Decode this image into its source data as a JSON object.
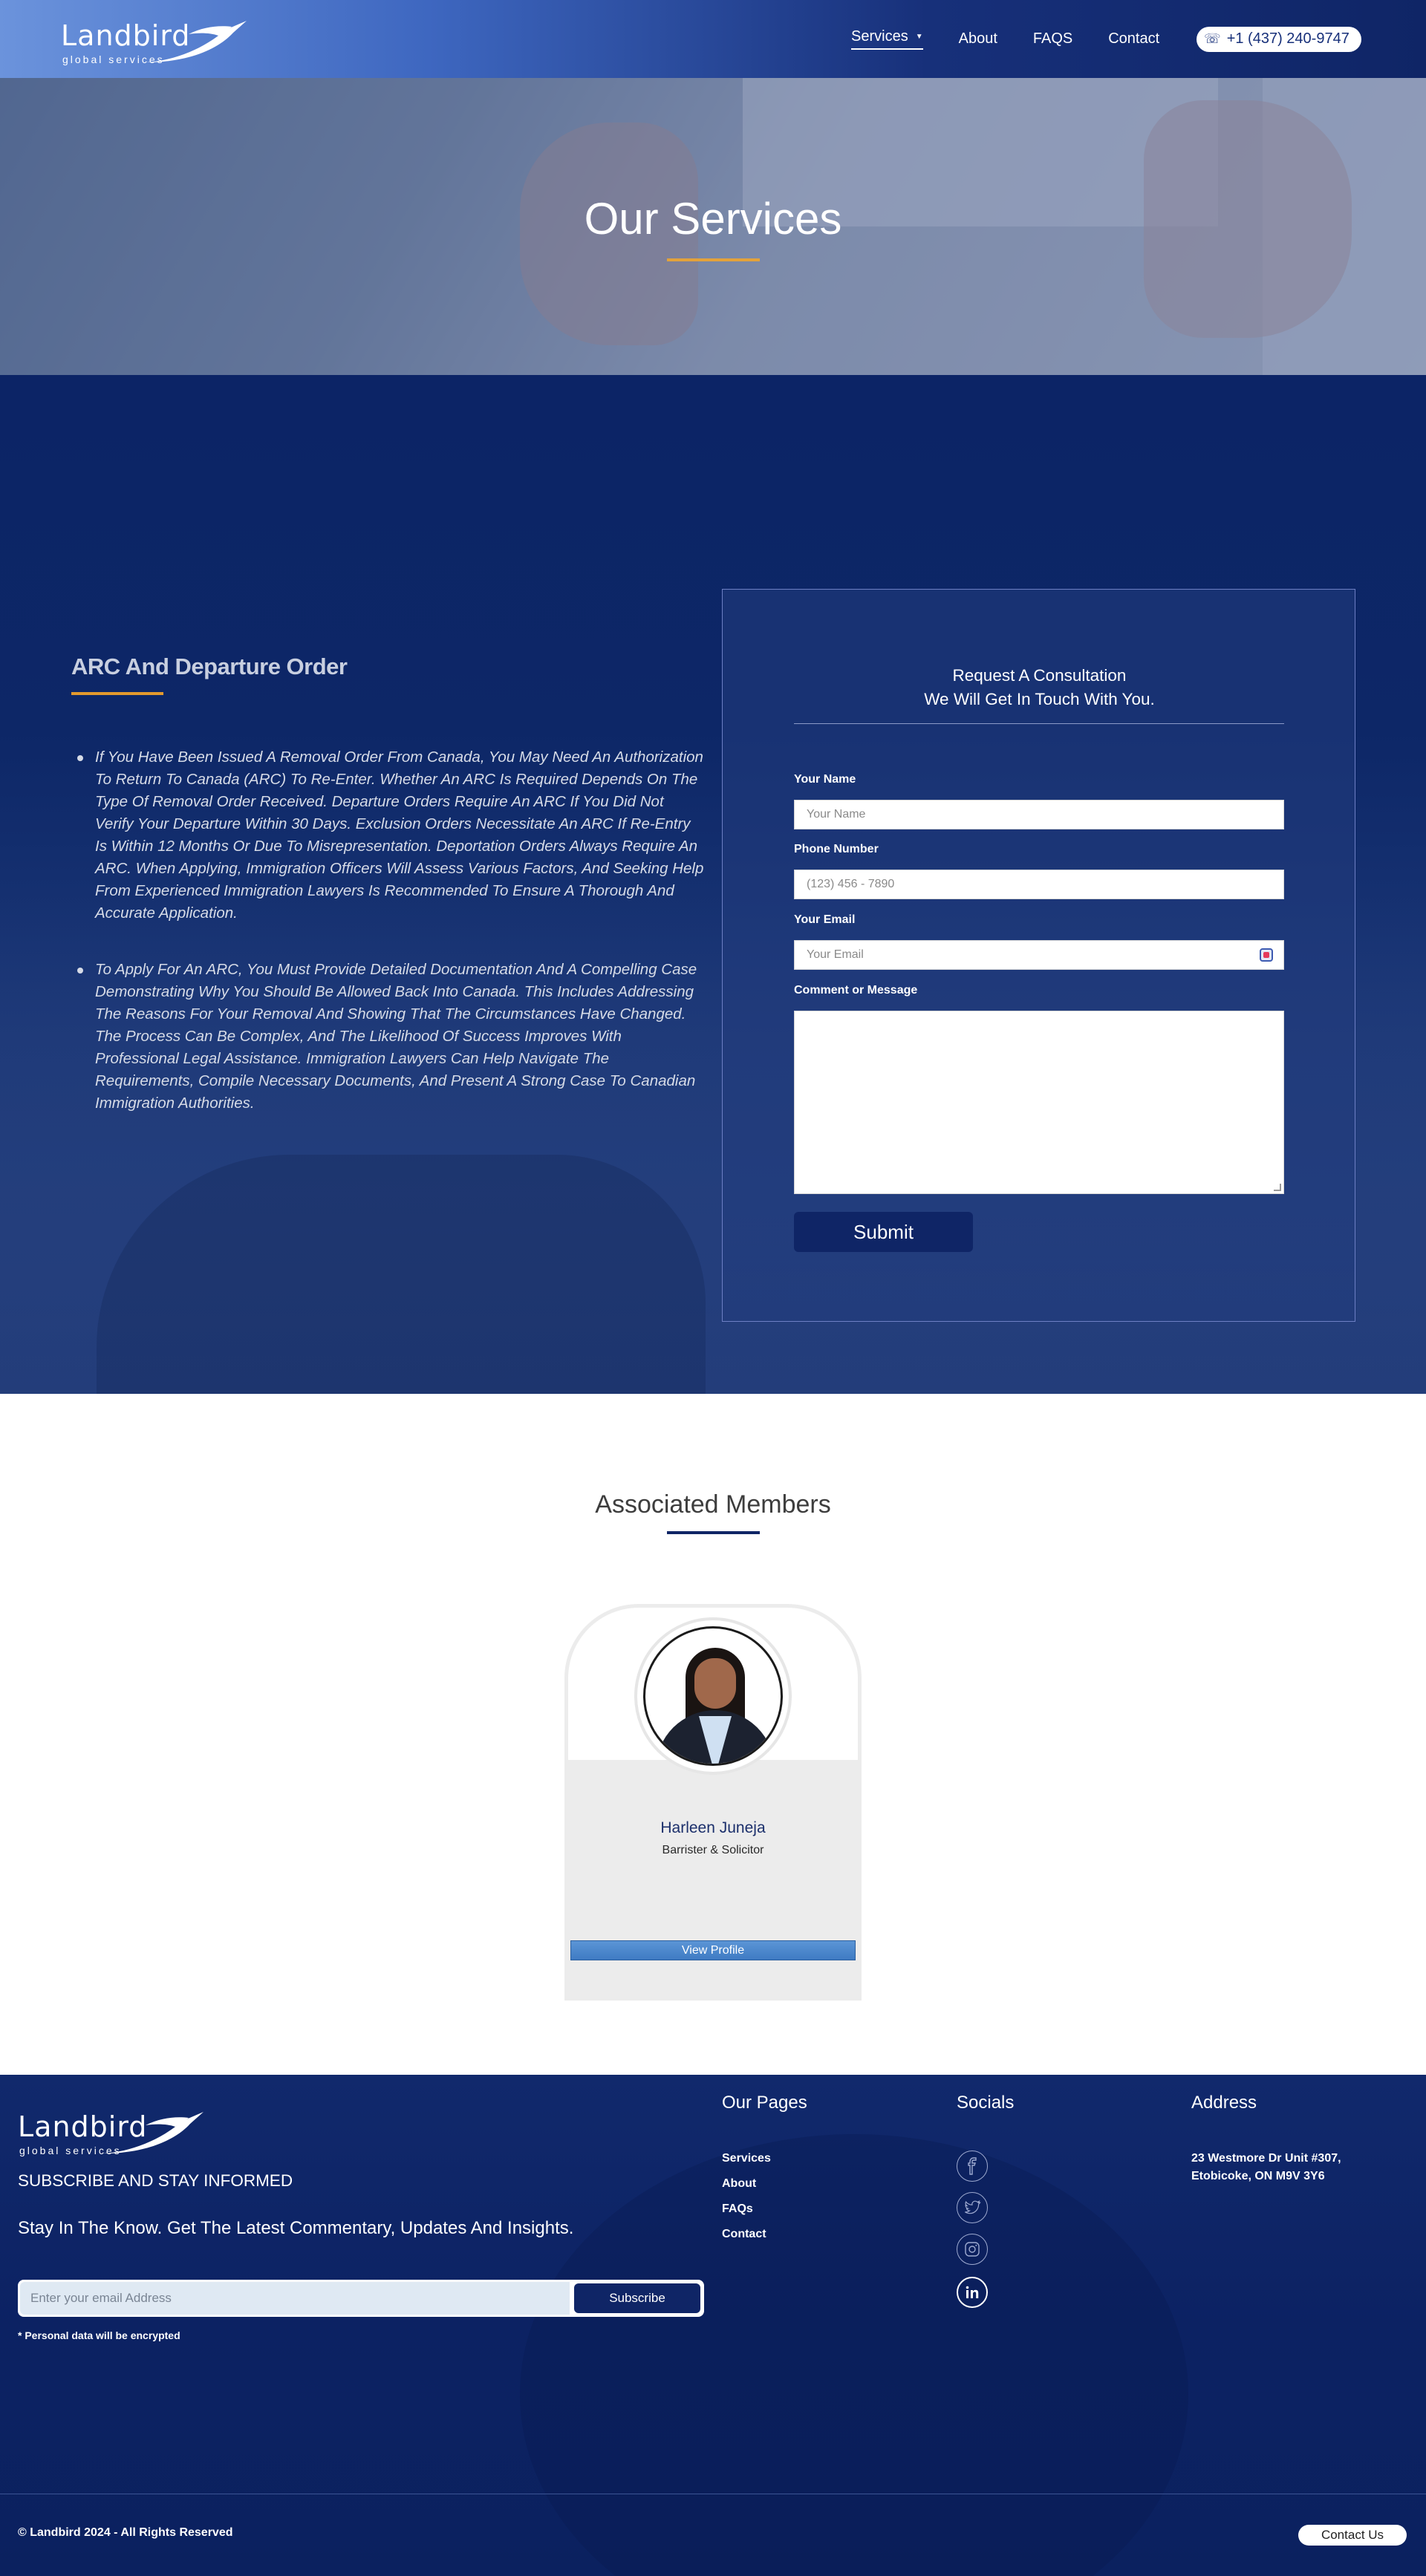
{
  "header": {
    "logo": {
      "wordmark": "Landbird",
      "tagline": "global services"
    },
    "nav": [
      {
        "label": "Services"
      },
      {
        "label": "About"
      },
      {
        "label": "FAQS"
      },
      {
        "label": "Contact"
      }
    ],
    "phone": "+1 (437) 240-9747"
  },
  "hero": {
    "title": "Our Services"
  },
  "service": {
    "heading": "ARC And Departure Order",
    "paragraphs": [
      "If You Have Been Issued A Removal Order From Canada, You May Need An Authorization To Return To Canada (ARC) To Re-Enter. Whether An ARC Is Required Depends On The Type Of Removal Order Received. Departure Orders Require An ARC If You Did Not Verify Your Departure Within 30 Days. Exclusion Orders Necessitate An ARC If Re-Entry Is Within 12 Months Or Due To Misrepresentation. Deportation Orders Always Require An ARC. When Applying, Immigration Officers Will Assess Various Factors, And Seeking Help From Experienced Immigration Lawyers Is Recommended To Ensure A Thorough And Accurate Application.",
      "To Apply For An ARC, You Must Provide Detailed Documentation And A Compelling Case Demonstrating Why You Should Be Allowed Back Into Canada. This Includes Addressing The Reasons For Your Removal And Showing That The Circumstances Have Changed. The Process Can Be Complex, And The Likelihood Of Success Improves With Professional Legal Assistance. Immigration Lawyers Can Help Navigate The Requirements, Compile Necessary Documents, And Present A Strong Case To Canadian Immigration Authorities."
    ]
  },
  "form": {
    "title_line1": "Request A Consultation",
    "title_line2": "We Will Get In Touch With You.",
    "name_label": "Your Name",
    "name_placeholder": "Your Name",
    "phone_label": "Phone Number",
    "phone_placeholder": "(123) 456 - 7890",
    "email_label": "Your Email",
    "email_placeholder": "Your Email",
    "message_label": "Comment or Message",
    "submit_label": "Submit"
  },
  "members": {
    "heading": "Associated Members",
    "people": [
      {
        "name": "Harleen Juneja",
        "role": "Barrister & Solicitor",
        "button": "View Profile"
      }
    ]
  },
  "footer": {
    "logo": {
      "wordmark": "Landbird",
      "tagline": "global services"
    },
    "subscribe_title": "SUBSCRIBE AND STAY INFORMED",
    "stay_text": "Stay In The Know. Get The Latest Commentary, Updates And Insights.",
    "email_placeholder": "Enter your email Address",
    "subscribe_button": "Subscribe",
    "encrypted_note": "* Personal data will be encrypted",
    "pages_heading": "Our Pages",
    "pages": [
      "Services",
      "About",
      "FAQs",
      "Contact"
    ],
    "socials_heading": "Socials",
    "socials": [
      "facebook-icon",
      "twitter-icon",
      "instagram-icon",
      "linkedin-icon"
    ],
    "address_heading": "Address",
    "address_line1": "23 Westmore Dr Unit #307,",
    "address_line2": "Etobicoke, ON M9V 3Y6",
    "copyright": "© Landbird 2024 - All Rights Reserved",
    "contact_button": "Contact Us"
  },
  "colors": {
    "navy": "#0f2566",
    "accent_orange": "#e3a23b",
    "view_profile_blue": "#4a86cc"
  }
}
